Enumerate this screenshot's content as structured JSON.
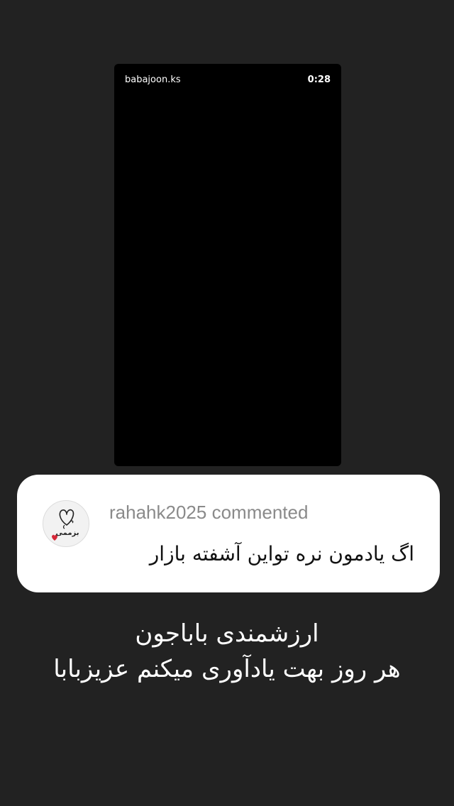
{
  "video": {
    "username": "babajoon.ks",
    "duration": "0:28"
  },
  "comment": {
    "author": "rahahk2025",
    "action": "commented",
    "text": "اگ یادمون نره تواین آشفته بازار",
    "avatar_text": "بزممی"
  },
  "caption": {
    "line1": "ارزشمندی باباجون",
    "line2": "هر روز بهت یادآوری میکنم عزیزبابا"
  },
  "colors": {
    "background": "#222222",
    "video_background": "#000000",
    "comment_card": "#ffffff",
    "comment_header": "#8a8a8a",
    "heart": "#d62839"
  },
  "icons": {
    "avatar": "heart-sketch-avatar"
  }
}
